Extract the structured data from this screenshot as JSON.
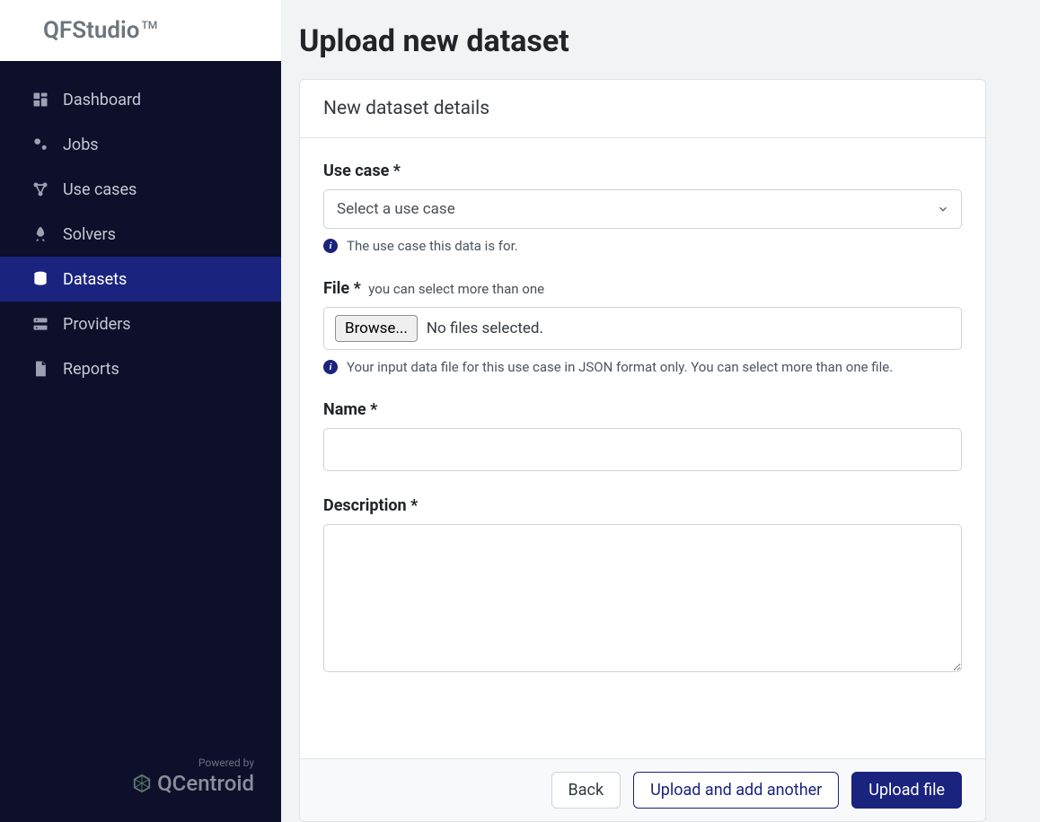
{
  "app": {
    "name": "QFStudio",
    "trademark": "TM"
  },
  "sidebar": {
    "items": [
      {
        "label": "Dashboard"
      },
      {
        "label": "Jobs"
      },
      {
        "label": "Use cases"
      },
      {
        "label": "Solvers"
      },
      {
        "label": "Datasets"
      },
      {
        "label": "Providers"
      },
      {
        "label": "Reports"
      }
    ],
    "footer": {
      "powered_by": "Powered by",
      "brand": "QCentroid"
    }
  },
  "page": {
    "title": "Upload new dataset",
    "card_title": "New dataset details"
  },
  "form": {
    "usecase": {
      "label": "Use case",
      "required": "*",
      "placeholder": "Select a use case",
      "help": "The use case this data is for."
    },
    "file": {
      "label": "File",
      "required": "*",
      "sublabel": "you can select more than one",
      "browse": "Browse...",
      "status": "No files selected.",
      "help": "Your input data file for this use case in JSON format only. You can select more than one file."
    },
    "name": {
      "label": "Name",
      "required": "*",
      "value": ""
    },
    "description": {
      "label": "Description",
      "required": "*",
      "value": ""
    }
  },
  "actions": {
    "back": "Back",
    "upload_another": "Upload and add another",
    "upload": "Upload file"
  }
}
